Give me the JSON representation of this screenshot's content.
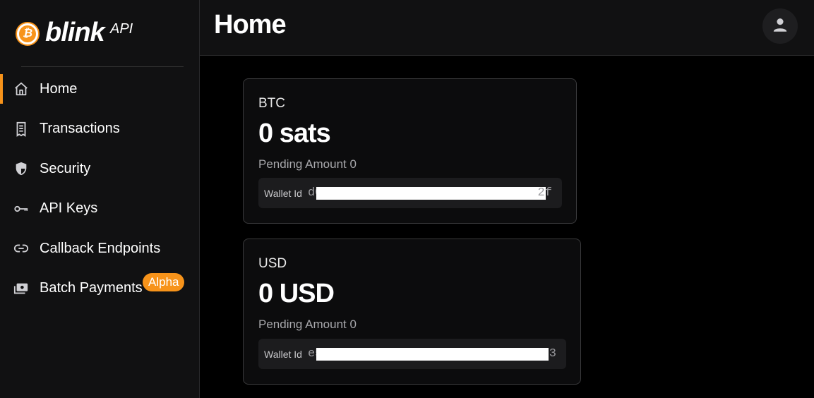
{
  "sidebar": {
    "logo": {
      "brand": "blink",
      "suffix": "API"
    },
    "items": [
      {
        "label": "Home",
        "icon": "home-icon",
        "active": true
      },
      {
        "label": "Transactions",
        "icon": "receipt-icon"
      },
      {
        "label": "Security",
        "icon": "shield-icon"
      },
      {
        "label": "API Keys",
        "icon": "key-icon"
      },
      {
        "label": "Callback Endpoints",
        "icon": "link-icon"
      },
      {
        "label": "Batch Payments",
        "icon": "payments-icon",
        "badge": "Alpha"
      }
    ]
  },
  "header": {
    "title": "Home",
    "account_icon": "account-icon"
  },
  "wallets": [
    {
      "currency": "BTC",
      "balance": "0 sats",
      "pending": "Pending Amount 0",
      "wallet_label": "Wallet Id",
      "id_start": "d0",
      "id_end": "2f"
    },
    {
      "currency": "USD",
      "balance": "0 USD",
      "pending": "Pending Amount 0",
      "wallet_label": "Wallet Id",
      "id_start": "e5",
      "id_end": "3"
    }
  ],
  "colors": {
    "accent": "#f7931a",
    "sidebar_bg": "#111112",
    "card_border": "#3a3a3c"
  }
}
